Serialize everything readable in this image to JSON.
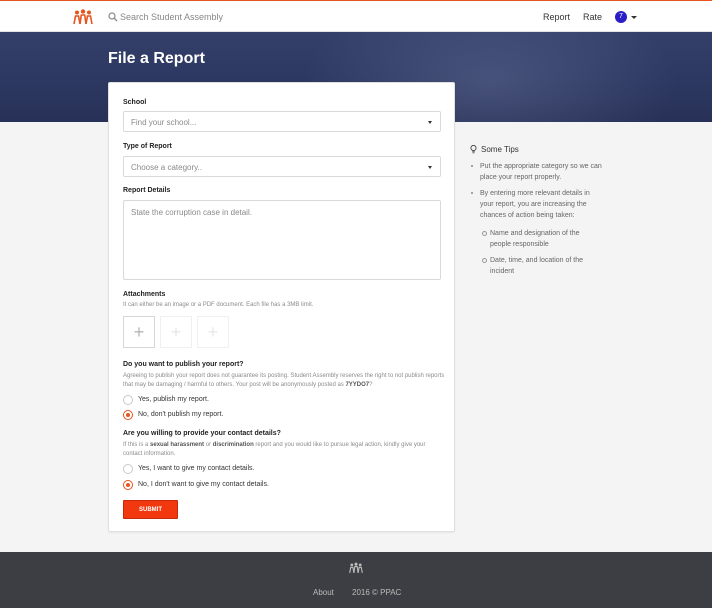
{
  "header": {
    "search_placeholder": "Search Student Assembly",
    "nav": [
      "Report",
      "Rate"
    ],
    "user_badge": "7"
  },
  "hero": {
    "title": "File a Report"
  },
  "form": {
    "school_label": "School",
    "school_placeholder": "Find your school...",
    "type_label": "Type of Report",
    "type_placeholder": "Choose a category..",
    "details_label": "Report Details",
    "details_placeholder": "State the corruption case in detail.",
    "attachments_label": "Attachments",
    "attachments_help": "It can either be an image or a PDF document. Each file has a 3MB limit.",
    "publish_question": "Do you want to publish your report?",
    "publish_help": "Agreeing to publish your report does not guarantee its posting. Student Assembly reserves the right to not publish reports that may be damaging / harmful to others. Your post will be anonymously posted as",
    "publish_alias": "7YYDO7",
    "publish_options": [
      "Yes, publish my report.",
      "No, don't publish my report."
    ],
    "publish_selected": 1,
    "contact_question": "Are you willing to provide your contact details?",
    "contact_help_1": "If this is a",
    "contact_help_term1": "sexual harassment",
    "contact_help_2": "or",
    "contact_help_term2": "discrimination",
    "contact_help_3": "report and you would like to pursue legal action, kindly give your contact information.",
    "contact_options": [
      "Yes, I want to give my contact details.",
      "No, I don't want to give my contact details."
    ],
    "contact_selected": 1,
    "submit_label": "Submit"
  },
  "tips": {
    "title": "Some Tips",
    "items": [
      "Put the appropriate category so we can place your report properly.",
      "By entering more relevant details in your report, you are increasing the chances of action being taken:"
    ],
    "subitems": [
      "Name and designation of the people responsible",
      "Date, time, and location of the incident"
    ]
  },
  "footer": {
    "links": [
      "About",
      "2016 © PPAC"
    ]
  },
  "colors": {
    "accent": "#e8541e",
    "submit": "#f1380f",
    "hero": "#2c3760",
    "footer": "#3d3e43",
    "badge": "#2a1fc7"
  }
}
